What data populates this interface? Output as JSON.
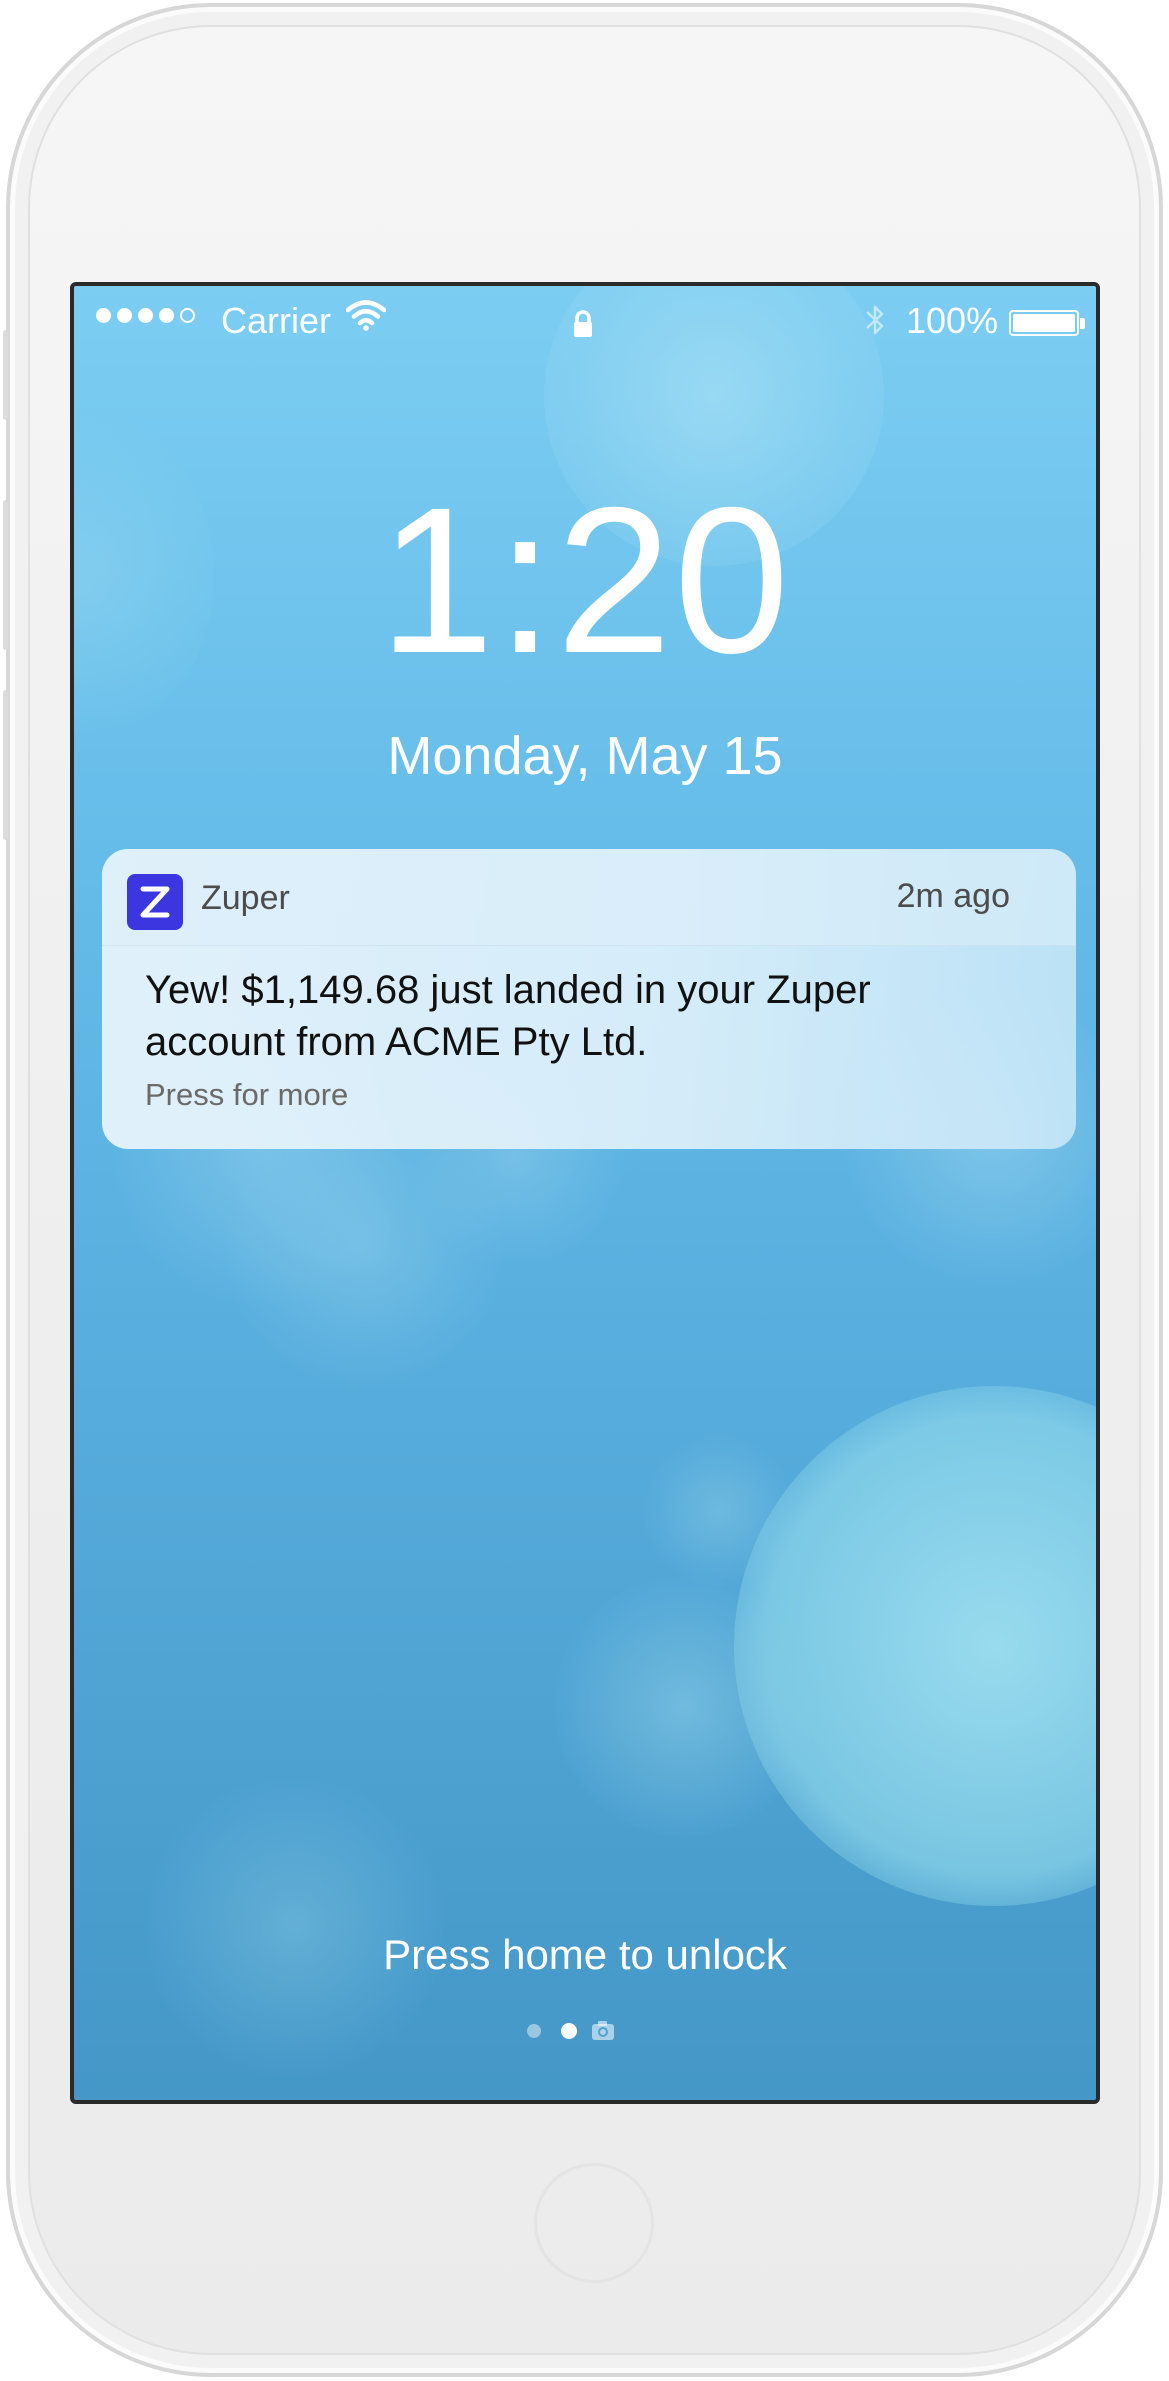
{
  "status_bar": {
    "carrier": "Carrier",
    "signal_bars": 4,
    "signal_max": 5,
    "battery_percent_label": "100%",
    "battery_level": 1.0,
    "icons": [
      "wifi-icon",
      "lock-icon",
      "bluetooth-icon",
      "battery-icon"
    ]
  },
  "lock_screen": {
    "time": "1:20",
    "date": "Monday, May 15",
    "unlock_hint": "Press home to unlock",
    "pages": [
      "dot",
      "dot-active",
      "camera-icon"
    ]
  },
  "notification": {
    "app_name": "Zuper",
    "age": "2m ago",
    "message": "Yew! $1,149.68 just landed in your Zuper account from ACME Pty Ltd.",
    "more": "Press for more"
  },
  "colors": {
    "app_icon": "#3b36e0",
    "wallpaper_top": "#7ccdf2",
    "wallpaper_bottom": "#4497c7"
  }
}
